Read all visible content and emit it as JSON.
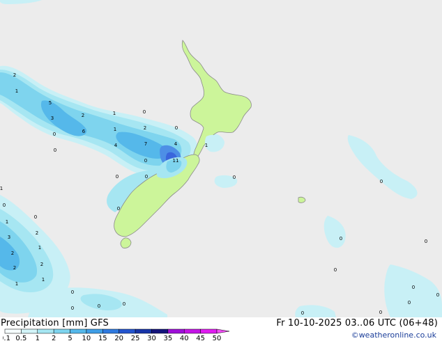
{
  "map": {
    "colors": {
      "ocean": "#ececec",
      "land": "#ccf59a",
      "coast": "#8a8a8a",
      "precip_light": "#c8f0f6",
      "precip_mid": "#a6e6f2",
      "precip_med": "#7ed4ee",
      "precip_heavy": "#55b8ea",
      "precip_heavier": "#4d8fe6",
      "precip_max": "#3a66dc"
    },
    "point_labels": [
      {
        "text": "2"
      },
      {
        "text": "1"
      },
      {
        "text": "5"
      },
      {
        "text": "2"
      },
      {
        "text": "1"
      },
      {
        "text": "0"
      },
      {
        "text": "3"
      },
      {
        "text": "6"
      },
      {
        "text": "1"
      },
      {
        "text": "2"
      },
      {
        "text": "0"
      },
      {
        "text": "0"
      },
      {
        "text": "0"
      },
      {
        "text": "4"
      },
      {
        "text": "7"
      },
      {
        "text": "4"
      },
      {
        "text": "11"
      },
      {
        "text": "1"
      },
      {
        "text": "0"
      },
      {
        "text": "0"
      },
      {
        "text": "0"
      },
      {
        "text": "0"
      },
      {
        "text": "0"
      },
      {
        "text": "1"
      },
      {
        "text": "0"
      },
      {
        "text": "0"
      },
      {
        "text": "1"
      },
      {
        "text": "0"
      },
      {
        "text": "3"
      },
      {
        "text": "2"
      },
      {
        "text": "1"
      },
      {
        "text": "2"
      },
      {
        "text": "2"
      },
      {
        "text": "2"
      },
      {
        "text": "1"
      },
      {
        "text": "1"
      },
      {
        "text": "0"
      },
      {
        "text": "0"
      },
      {
        "text": "0"
      },
      {
        "text": "0"
      },
      {
        "text": "0"
      },
      {
        "text": "0"
      },
      {
        "text": "0"
      },
      {
        "text": "0"
      },
      {
        "text": "0"
      },
      {
        "text": "0"
      },
      {
        "text": "0"
      },
      {
        "text": "0"
      }
    ]
  },
  "legend": {
    "title": "Precipitation [mm]  GFS",
    "datetime": "Fr 10-10-2025 03..06 UTC (06+48)",
    "credit": "©weatheronline.co.uk",
    "scale": [
      {
        "label": "0.1",
        "color": "#f6fdfe"
      },
      {
        "label": "0.5",
        "color": "#d2f4f8"
      },
      {
        "label": "1",
        "color": "#a6e6f2"
      },
      {
        "label": "2",
        "color": "#7ed4ee"
      },
      {
        "label": "5",
        "color": "#55b8ea"
      },
      {
        "label": "10",
        "color": "#3f9ee6"
      },
      {
        "label": "15",
        "color": "#2f7ae0"
      },
      {
        "label": "20",
        "color": "#2455cf"
      },
      {
        "label": "25",
        "color": "#1734a8"
      },
      {
        "label": "30",
        "color": "#14147c"
      },
      {
        "label": "35",
        "color": "#9e10d8"
      },
      {
        "label": "40",
        "color": "#c414e6"
      },
      {
        "label": "45",
        "color": "#e01cf0"
      },
      {
        "label": "50",
        "color": "#f24cf6"
      }
    ]
  }
}
